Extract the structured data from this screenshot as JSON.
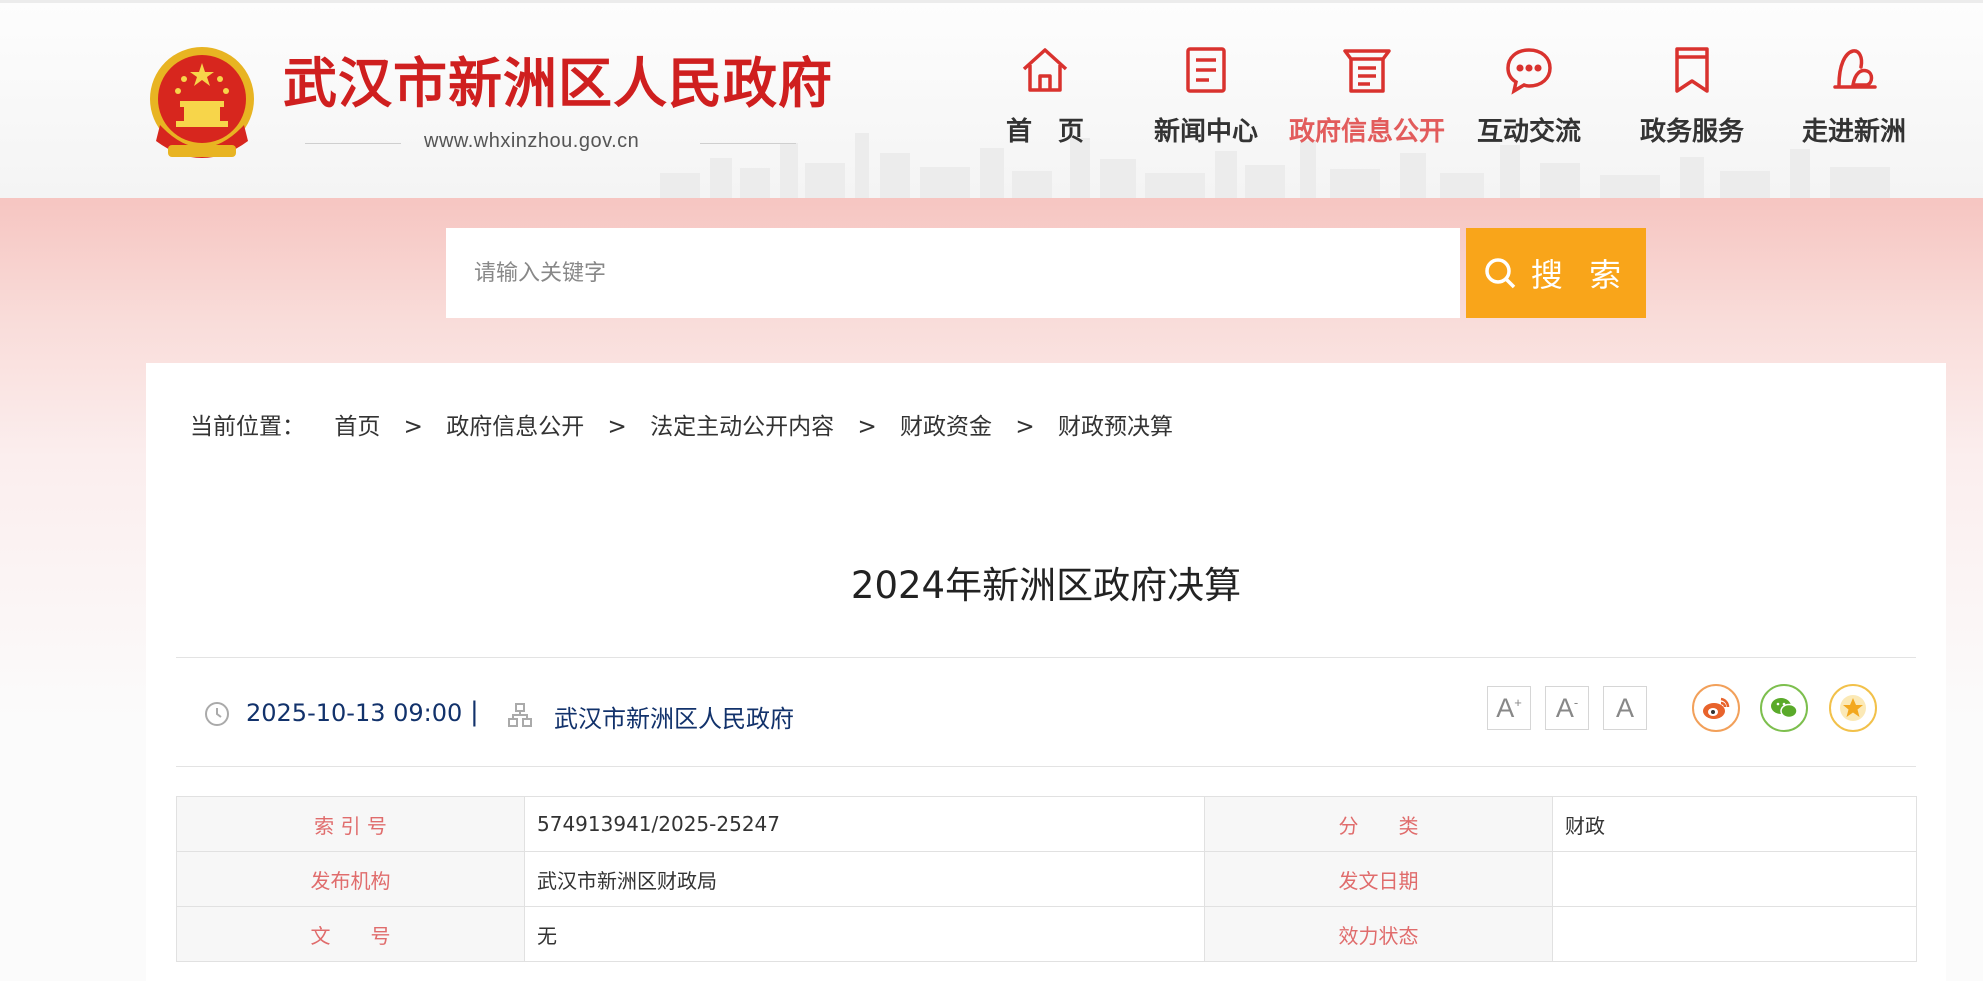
{
  "header": {
    "site_title": "武汉市新洲区人民政府",
    "site_url": "www.whxinzhou.gov.cn",
    "emblem_icon": "national-emblem-icon",
    "nav": [
      {
        "label": "首　页",
        "icon": "home-icon",
        "active": false
      },
      {
        "label": "新闻中心",
        "icon": "news-document-icon",
        "active": false
      },
      {
        "label": "政府信息公开",
        "icon": "info-disclosure-icon",
        "active": true
      },
      {
        "label": "互动交流",
        "icon": "chat-bubble-icon",
        "active": false
      },
      {
        "label": "政务服务",
        "icon": "bookmark-icon",
        "active": false
      },
      {
        "label": "走进新洲",
        "icon": "landmark-icon",
        "active": false
      }
    ]
  },
  "search": {
    "placeholder": "请输入关键字",
    "button_label": "搜 索",
    "button_icon": "search-icon"
  },
  "breadcrumb": {
    "prefix": "当前位置：",
    "separator": ">",
    "items": [
      "首页",
      "政府信息公开",
      "法定主动公开内容",
      "财政资金",
      "财政预决算"
    ]
  },
  "article": {
    "title": "2024年新洲区政府决算",
    "date": "2025-10-13 09:00",
    "pipe": "|",
    "publisher": "武汉市新洲区人民政府",
    "font_controls": [
      "A",
      "A",
      "A"
    ],
    "share": [
      "weibo-icon",
      "wechat-icon",
      "favorite-star-icon"
    ]
  },
  "info_table": {
    "rows": [
      {
        "k1": "索 引 号",
        "v1": "574913941/2025-25247",
        "k2": "分　　类",
        "v2": "财政"
      },
      {
        "k1": "发布机构",
        "v1": "武汉市新洲区财政局",
        "k2": "发文日期",
        "v2": ""
      },
      {
        "k1": "文　　号",
        "v1": "无",
        "k2": "效力状态",
        "v2": ""
      }
    ]
  },
  "colors": {
    "title_red": "#cf1f1f",
    "nav_active": "#e25c5c",
    "search_button": "#f9a51a",
    "meta_blue": "#12326b",
    "table_key": "#e06c6c"
  }
}
